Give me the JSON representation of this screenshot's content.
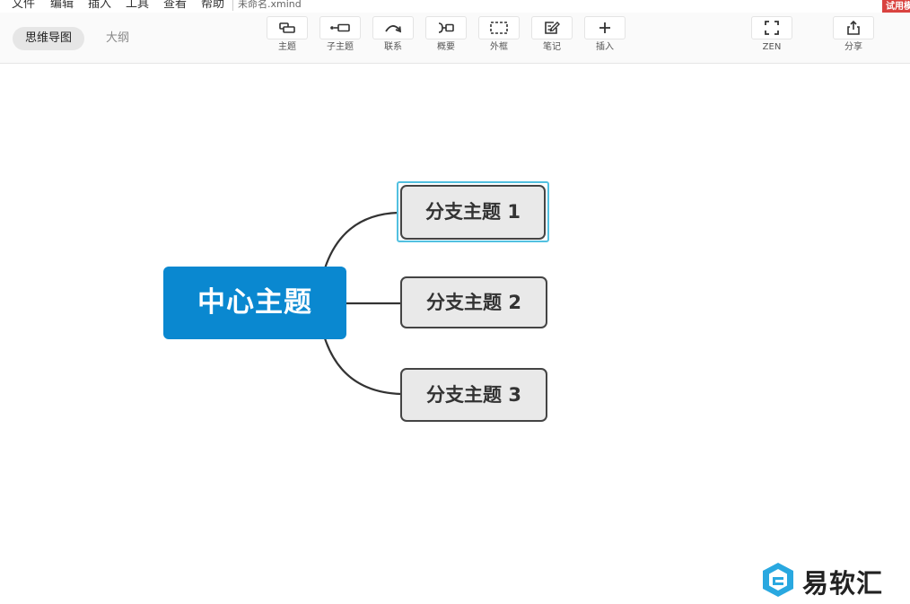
{
  "menu": {
    "items": [
      "文件",
      "编辑",
      "插入",
      "工具",
      "查看",
      "帮助"
    ],
    "file_name": "未命名.xmind",
    "trial_badge": "试用模"
  },
  "toolbar": {
    "view_tabs": {
      "mindmap": "思维导图",
      "outline": "大纲"
    },
    "tools": {
      "topic": "主题",
      "subtopic": "子主题",
      "relationship": "联系",
      "summary": "概要",
      "boundary": "外框",
      "note": "笔记",
      "insert": "插入",
      "zen": "ZEN",
      "share": "分享"
    }
  },
  "mindmap": {
    "central": "中心主题",
    "branches": [
      "分支主题 1",
      "分支主题 2",
      "分支主题 3"
    ],
    "selected_branch": "分支主题 1"
  },
  "watermark": {
    "text": "易软汇"
  },
  "colors": {
    "central_fill": "#0a88d0",
    "branch_fill": "#e9e9e9",
    "selection": "#52c0e0",
    "trial_badge": "#d9423f"
  }
}
